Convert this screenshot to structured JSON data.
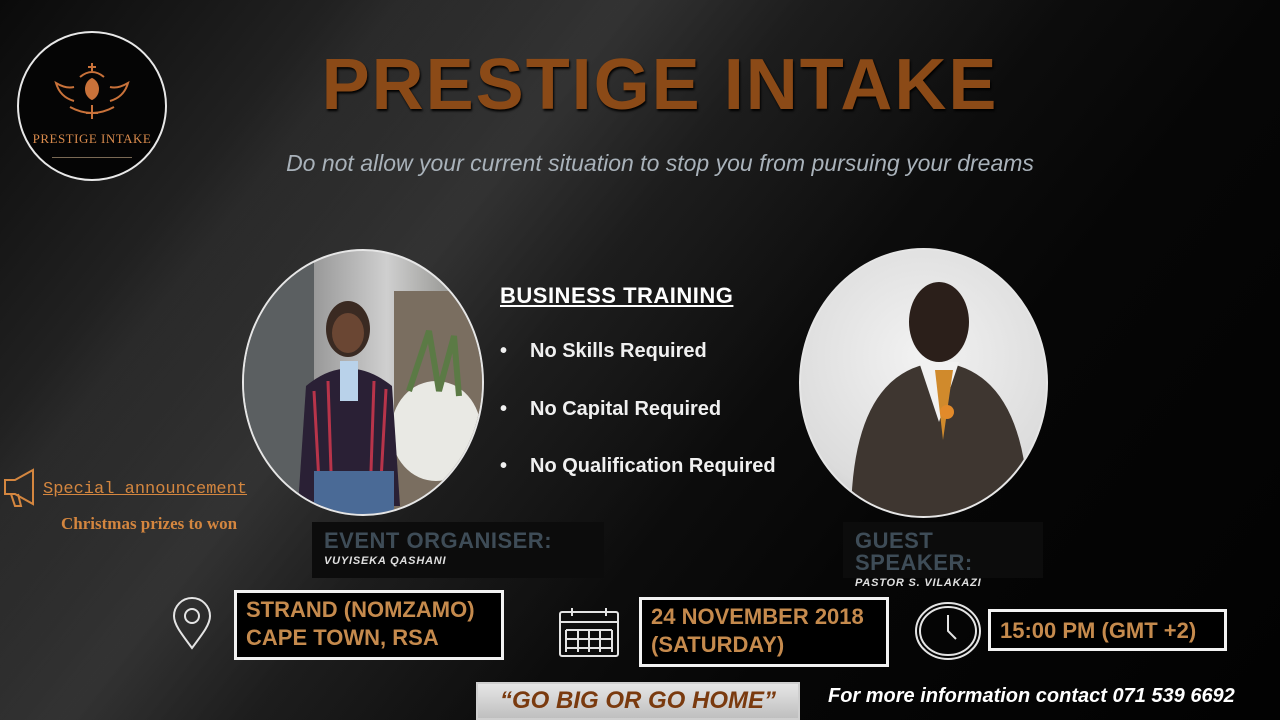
{
  "brand": {
    "logo_text": "PRESTIGE INTAKE",
    "title": "PRESTIGE INTAKE",
    "tagline": "Do not allow your current situation to stop you from pursuing your dreams",
    "accent": "#8b4a17"
  },
  "training": {
    "title": "BUSINESS TRAINING",
    "items": [
      "No Skills Required",
      "No Capital Required",
      "No Qualification Required"
    ],
    "bullet": "•"
  },
  "organiser": {
    "role": "EVENT ORGANISER:",
    "name": "VUYISEKA QASHANI"
  },
  "speaker": {
    "role": "GUEST SPEAKER:",
    "name": "PASTOR S. VILAKAZI"
  },
  "announcement": {
    "icon": "megaphone-icon",
    "title": " Special announcement",
    "subtitle": "Christmas prizes to won"
  },
  "details": {
    "location_lines": [
      "STRAND (NOMZAMO)",
      "CAPE TOWN, RSA"
    ],
    "date_lines": [
      "24 NOVEMBER 2018",
      "(SATURDAY)"
    ],
    "time": "15:00 PM (GMT +2)",
    "icons": [
      "location-pin-icon",
      "calendar-icon",
      "clock-icon"
    ]
  },
  "footer": {
    "slogan": "“GO BIG OR GO HOME”",
    "contact": "For more information contact  071 539 6692"
  }
}
